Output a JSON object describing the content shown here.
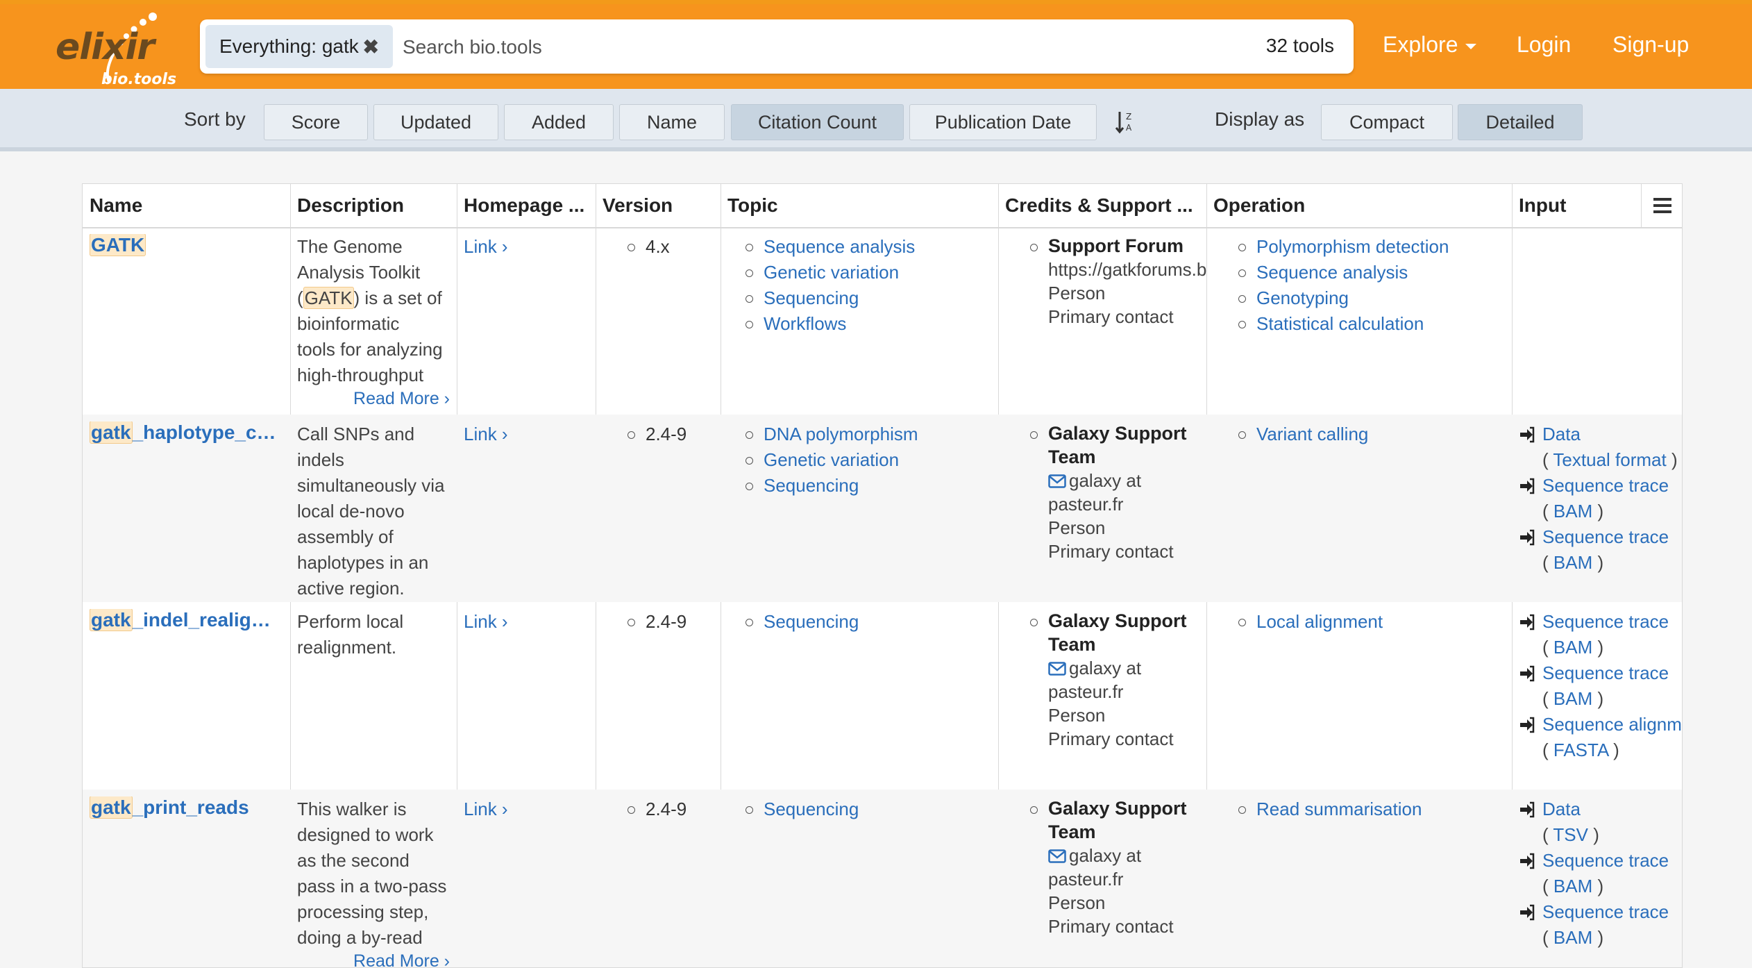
{
  "header": {
    "logo_text": "elixir",
    "logo_subtext": "bio.tools",
    "search_chip": "Everything: gatk",
    "search_placeholder": "Search bio.tools",
    "tool_count": "32 tools",
    "nav": {
      "explore": "Explore",
      "login": "Login",
      "signup": "Sign-up"
    },
    "accent_color": "#f7941d"
  },
  "toolbar": {
    "sort_by_label": "Sort by",
    "sort_options": [
      "Score",
      "Updated",
      "Added",
      "Name",
      "Citation Count",
      "Publication Date"
    ],
    "active_sort": "Citation Count",
    "display_as_label": "Display as",
    "display_options": [
      "Compact",
      "Detailed"
    ],
    "active_display": "Detailed"
  },
  "table": {
    "columns": [
      "Name",
      "Description",
      "Homepage ...",
      "Version",
      "Topic",
      "Credits & Support ...",
      "Operation",
      "Input"
    ],
    "rows": [
      {
        "name_prefix": "GATK",
        "name_rest": "",
        "description": [
          "The Genome",
          "Analysis Toolkit"
        ],
        "description_hl_pre": "(",
        "description_hl": "GATK",
        "description_hl_post": ") is a set of",
        "description_rest": [
          "bioinformatic",
          "tools for analyzing",
          "high-throughput"
        ],
        "read_more": "Read More ›",
        "homepage": "Link ›",
        "version": "4.x",
        "topics": [
          "Sequence analysis",
          "Genetic variation",
          "Sequencing",
          "Workflows"
        ],
        "credit_name": "Support Forum",
        "credit_url": "https://gatkforums.b",
        "credit_type": "Person",
        "credit_role": "Primary contact",
        "operations": [
          "Polymorphism detection",
          "Sequence analysis",
          "Genotyping",
          "Statistical calculation"
        ]
      },
      {
        "name_prefix": "gatk",
        "name_rest": "_haplotype_cal...",
        "description": [
          "Call SNPs and",
          "indels",
          "simultaneously via",
          "local de-novo",
          "assembly of",
          "haplotypes in an",
          "active region."
        ],
        "homepage": "Link ›",
        "version": "2.4-9",
        "topics": [
          "DNA polymorphism",
          "Genetic variation",
          "Sequencing"
        ],
        "credit_name": [
          "Galaxy Support",
          "Team"
        ],
        "credit_email": [
          "galaxy at",
          "pasteur.fr"
        ],
        "credit_type": "Person",
        "credit_role": "Primary contact",
        "operations": [
          "Variant calling"
        ],
        "inputs": [
          {
            "data": "Data",
            "format": "Textual format"
          },
          {
            "data": "Sequence trace",
            "format": "BAM"
          },
          {
            "data": "Sequence trace",
            "format": "BAM"
          }
        ]
      },
      {
        "name_prefix": "gatk",
        "name_rest": "_indel_realigner",
        "description": [
          "Perform local",
          "realignment."
        ],
        "homepage": "Link ›",
        "version": "2.4-9",
        "topics": [
          "Sequencing"
        ],
        "credit_name": [
          "Galaxy Support",
          "Team"
        ],
        "credit_email": [
          "galaxy at",
          "pasteur.fr"
        ],
        "credit_type": "Person",
        "credit_role": "Primary contact",
        "operations": [
          "Local alignment"
        ],
        "inputs": [
          {
            "data": "Sequence trace",
            "format": "BAM"
          },
          {
            "data": "Sequence trace",
            "format": "BAM"
          },
          {
            "data": "Sequence alignment",
            "format": "FASTA"
          }
        ]
      },
      {
        "name_prefix": "gatk",
        "name_rest": "_print_reads",
        "description": [
          "This walker is",
          "designed to work",
          "as the second",
          "pass in a two-pass",
          "processing step,",
          "doing a by-read"
        ],
        "read_more": "Read More ›",
        "homepage": "Link ›",
        "version": "2.4-9",
        "topics": [
          "Sequencing"
        ],
        "credit_name": [
          "Galaxy Support",
          "Team"
        ],
        "credit_email": [
          "galaxy at",
          "pasteur.fr"
        ],
        "credit_type": "Person",
        "credit_role": "Primary contact",
        "operations": [
          "Read summarisation"
        ],
        "inputs": [
          {
            "data": "Data",
            "format": "TSV"
          },
          {
            "data": "Sequence trace",
            "format": "BAM"
          },
          {
            "data": "Sequence trace",
            "format": "BAM"
          }
        ]
      }
    ]
  }
}
